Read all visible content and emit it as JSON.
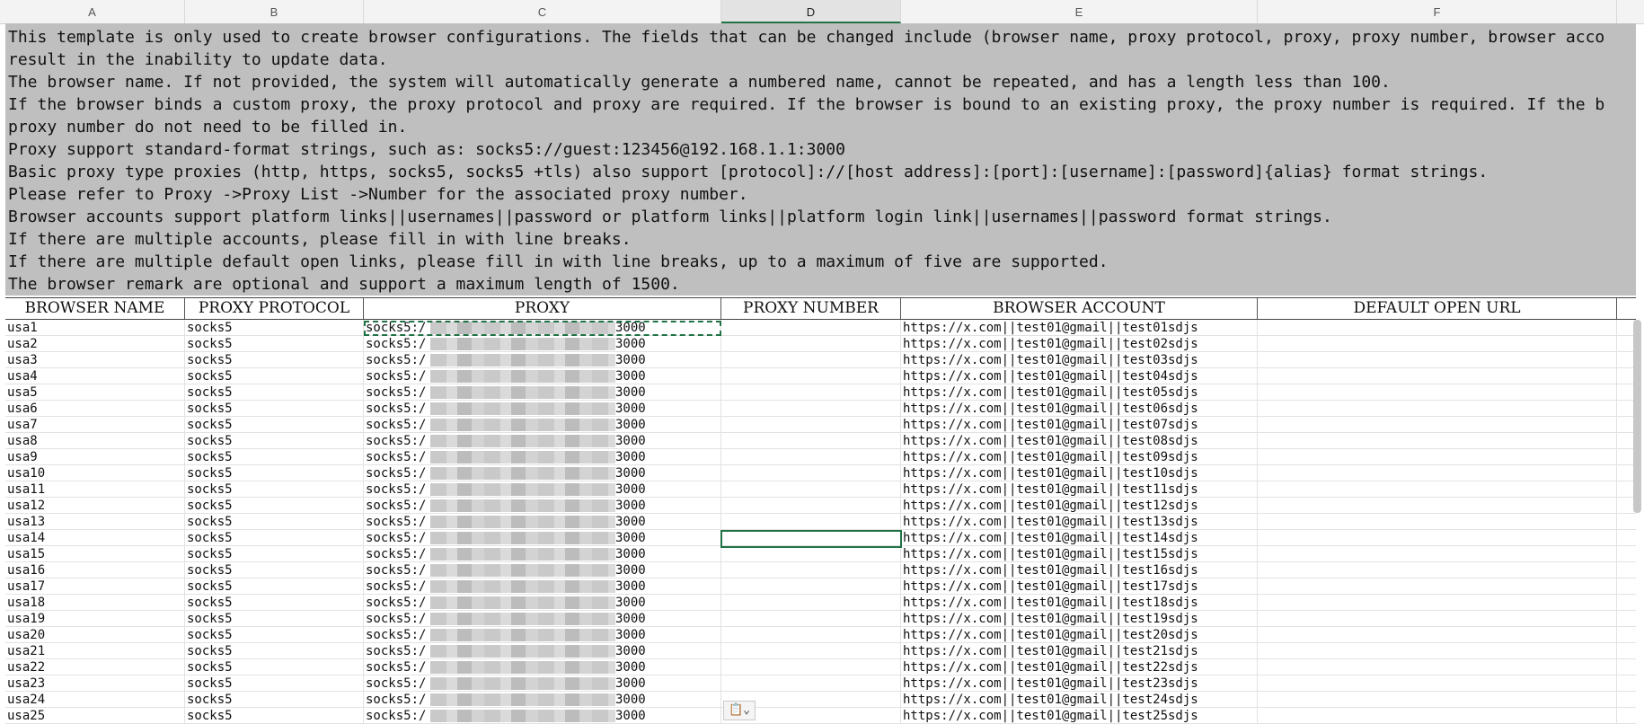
{
  "column_headers": [
    "A",
    "B",
    "C",
    "D",
    "E",
    "F"
  ],
  "active_column": "D",
  "instructions": [
    "This template is only used to create browser configurations. The fields that can be changed include (browser name, proxy protocol, proxy, proxy number, browser acco",
    "result in the inability to update data.",
    "The browser name. If not provided, the system will automatically generate a numbered name, cannot be repeated, and has a length less than 100.",
    "If the browser binds a custom proxy, the proxy protocol and proxy are required. If the browser is bound to an existing proxy, the proxy number is required. If the b",
    "proxy number do not need to be filled in.",
    "Proxy support standard-format strings, such as: socks5://guest:123456@192.168.1.1:3000",
    "Basic proxy type proxies (http, https, socks5, socks5 +tls) also support [protocol]://[host address]:[port]:[username]:[password]{alias} format strings.",
    "Please refer to Proxy ->Proxy List ->Number for the associated proxy number.",
    "Browser accounts support platform links||usernames||password or platform links||platform login link||usernames||password format strings.",
    "If there are multiple accounts, please fill in with line breaks.",
    "If there are multiple default open links, please fill in with line breaks, up to a maximum of five are supported.",
    "The browser remark are optional and support a maximum length of 1500."
  ],
  "table_headers": [
    "BROWSER NAME",
    "PROXY PROTOCOL",
    "PROXY",
    "PROXY NUMBER",
    "BROWSER ACCOUNT",
    "DEFAULT OPEN URL"
  ],
  "rows": [
    {
      "name": "usa1",
      "protocol": "socks5",
      "proxy_prefix": "socks5:/",
      "proxy_suffix": "3000",
      "account": "https://x.com||test01@gmail||test01sdjs"
    },
    {
      "name": "usa2",
      "protocol": "socks5",
      "proxy_prefix": "socks5:/",
      "proxy_suffix": "3000",
      "account": "https://x.com||test01@gmail||test02sdjs"
    },
    {
      "name": "usa3",
      "protocol": "socks5",
      "proxy_prefix": "socks5:/",
      "proxy_suffix": "3000",
      "account": "https://x.com||test01@gmail||test03sdjs"
    },
    {
      "name": "usa4",
      "protocol": "socks5",
      "proxy_prefix": "socks5:/",
      "proxy_suffix": "3000",
      "account": "https://x.com||test01@gmail||test04sdjs"
    },
    {
      "name": "usa5",
      "protocol": "socks5",
      "proxy_prefix": "socks5:/",
      "proxy_suffix": "3000",
      "account": "https://x.com||test01@gmail||test05sdjs"
    },
    {
      "name": "usa6",
      "protocol": "socks5",
      "proxy_prefix": "socks5:/",
      "proxy_suffix": "3000",
      "account": "https://x.com||test01@gmail||test06sdjs"
    },
    {
      "name": "usa7",
      "protocol": "socks5",
      "proxy_prefix": "socks5:/",
      "proxy_suffix": "3000",
      "account": "https://x.com||test01@gmail||test07sdjs"
    },
    {
      "name": "usa8",
      "protocol": "socks5",
      "proxy_prefix": "socks5:/",
      "proxy_suffix": "3000",
      "account": "https://x.com||test01@gmail||test08sdjs"
    },
    {
      "name": "usa9",
      "protocol": "socks5",
      "proxy_prefix": "socks5:/",
      "proxy_suffix": "3000",
      "account": "https://x.com||test01@gmail||test09sdjs"
    },
    {
      "name": "usa10",
      "protocol": "socks5",
      "proxy_prefix": "socks5:/",
      "proxy_suffix": "3000",
      "account": "https://x.com||test01@gmail||test10sdjs"
    },
    {
      "name": "usa11",
      "protocol": "socks5",
      "proxy_prefix": "socks5:/",
      "proxy_suffix": "3000",
      "account": "https://x.com||test01@gmail||test11sdjs"
    },
    {
      "name": "usa12",
      "protocol": "socks5",
      "proxy_prefix": "socks5:/",
      "proxy_suffix": "3000",
      "account": "https://x.com||test01@gmail||test12sdjs"
    },
    {
      "name": "usa13",
      "protocol": "socks5",
      "proxy_prefix": "socks5:/",
      "proxy_suffix": "3000",
      "account": "https://x.com||test01@gmail||test13sdjs"
    },
    {
      "name": "usa14",
      "protocol": "socks5",
      "proxy_prefix": "socks5:/",
      "proxy_suffix": "3000",
      "account": "https://x.com||test01@gmail||test14sdjs"
    },
    {
      "name": "usa15",
      "protocol": "socks5",
      "proxy_prefix": "socks5:/",
      "proxy_suffix": "3000",
      "account": "https://x.com||test01@gmail||test15sdjs"
    },
    {
      "name": "usa16",
      "protocol": "socks5",
      "proxy_prefix": "socks5:/",
      "proxy_suffix": "3000",
      "account": "https://x.com||test01@gmail||test16sdjs"
    },
    {
      "name": "usa17",
      "protocol": "socks5",
      "proxy_prefix": "socks5:/",
      "proxy_suffix": "3000",
      "account": "https://x.com||test01@gmail||test17sdjs"
    },
    {
      "name": "usa18",
      "protocol": "socks5",
      "proxy_prefix": "socks5:/",
      "proxy_suffix": "3000",
      "account": "https://x.com||test01@gmail||test18sdjs"
    },
    {
      "name": "usa19",
      "protocol": "socks5",
      "proxy_prefix": "socks5:/",
      "proxy_suffix": "3000",
      "account": "https://x.com||test01@gmail||test19sdjs"
    },
    {
      "name": "usa20",
      "protocol": "socks5",
      "proxy_prefix": "socks5:/",
      "proxy_suffix": "3000",
      "account": "https://x.com||test01@gmail||test20sdjs"
    },
    {
      "name": "usa21",
      "protocol": "socks5",
      "proxy_prefix": "socks5:/",
      "proxy_suffix": "3000",
      "account": "https://x.com||test01@gmail||test21sdjs"
    },
    {
      "name": "usa22",
      "protocol": "socks5",
      "proxy_prefix": "socks5:/",
      "proxy_suffix": "3000",
      "account": "https://x.com||test01@gmail||test22sdjs"
    },
    {
      "name": "usa23",
      "protocol": "socks5",
      "proxy_prefix": "socks5:/",
      "proxy_suffix": "3000",
      "account": "https://x.com||test01@gmail||test23sdjs"
    },
    {
      "name": "usa24",
      "protocol": "socks5",
      "proxy_prefix": "socks5:/",
      "proxy_suffix": "3000",
      "account": "https://x.com||test01@gmail||test24sdjs"
    },
    {
      "name": "usa25",
      "protocol": "socks5",
      "proxy_prefix": "socks5:/",
      "proxy_suffix": "3000",
      "account": "https://x.com||test01@gmail||test25sdjs"
    }
  ],
  "paste_options_icon": "clipboard-icon",
  "accent_color": "#217346"
}
